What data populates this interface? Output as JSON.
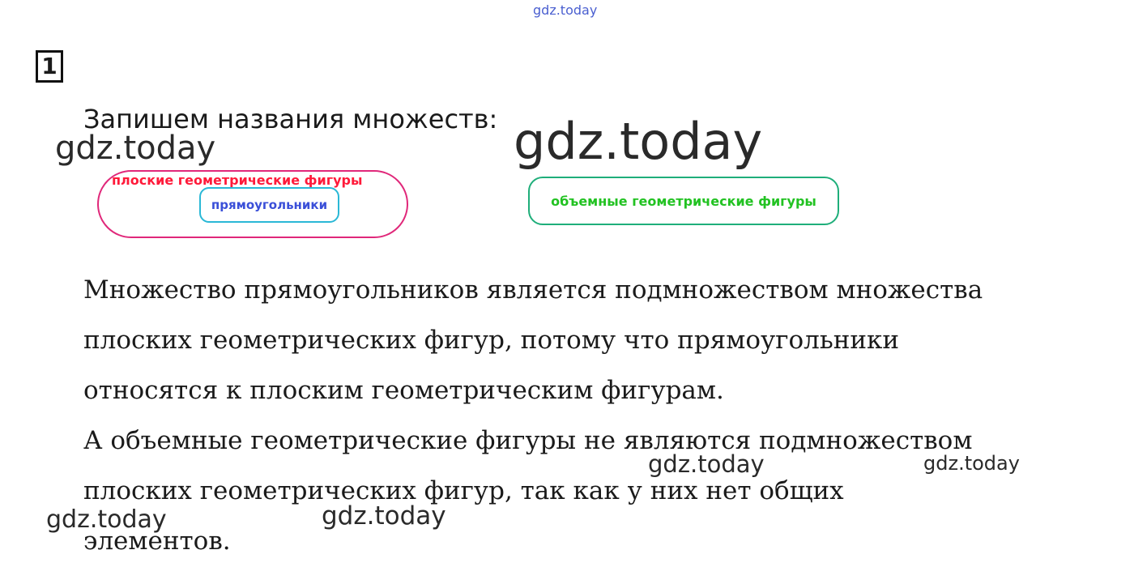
{
  "header": {
    "site": "gdz.today"
  },
  "task": {
    "number": "1"
  },
  "intro": "Запишем названия множеств:",
  "diagram": {
    "flat_figures": "плоские геометрические фигуры",
    "rectangles": "прямоугольники",
    "solid_figures": "объемные геометрические фигуры"
  },
  "paragraph1": [
    "Множество прямоугольников является подмножеством множества",
    "плоских геометрических фигур, потому что прямоугольники",
    "относятся к плоским геометрическим фигурам."
  ],
  "paragraph2": [
    "А объемные геометрические фигуры не являются подмножеством",
    "плоских геометрических фигур, так как у них нет общих",
    "элементов."
  ],
  "watermarks": [
    "gdz.today",
    "gdz.today",
    "gdz.today",
    "gdz.today",
    "gdz.today",
    "gdz.today"
  ],
  "colors": {
    "flat_border": "#e0287a",
    "flat_text": "#ff1a3a",
    "rect_border": "#2ab8d6",
    "rect_text": "#3a4fd8",
    "solid_border": "#1fae7a",
    "solid_text": "#22c222"
  }
}
